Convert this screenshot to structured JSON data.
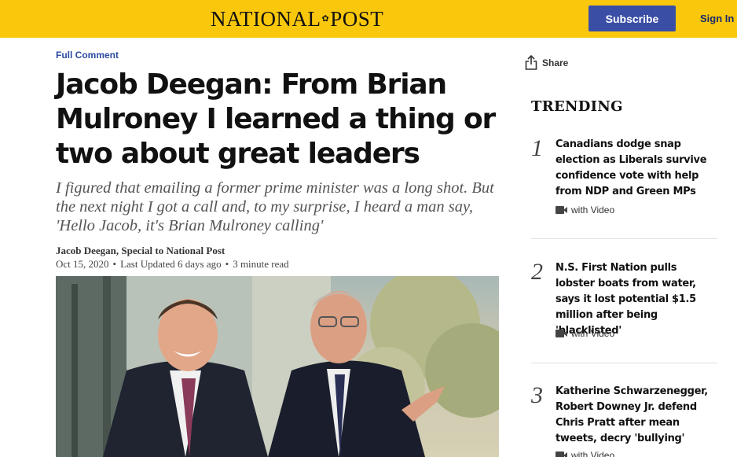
{
  "header": {
    "logo_left": "NATIONAL",
    "logo_right": "POST",
    "subscribe_label": "Subscribe",
    "signin_label": "Sign In",
    "brand_color": "#f9c70c",
    "subscribe_color": "#3b4ea5"
  },
  "article": {
    "category": "Full Comment",
    "headline": "Jacob Deegan: From Brian Mulroney I learned a thing or two about great leaders",
    "deck": "I figured that emailing a former prime minister was a long shot. But the next night I got a call and, to my surprise, I heard a man say, 'Hello Jacob, it's Brian Mulroney calling'",
    "byline": "Jacob Deegan, Special to National Post",
    "date": "Oct 15, 2020",
    "updated": "Last Updated 6 days ago",
    "read_time": "3 minute read"
  },
  "share": {
    "label": "Share",
    "icon": "share-icon"
  },
  "trending": {
    "title": "TRENDING",
    "items": [
      {
        "num": "1",
        "text": "Canadians dodge snap election as Liberals survive confidence vote with help from NDP and Green MPs",
        "tag": "with Video"
      },
      {
        "num": "2",
        "text": "N.S. First Nation pulls lobster boats from water, says it lost potential $1.5 million after being 'blacklisted'",
        "tag": "with Video"
      },
      {
        "num": "3",
        "text": "Katherine Schwarzenegger, Robert Downey Jr. defend Chris Pratt after mean tweets, decry 'bullying'",
        "tag": "with Video"
      }
    ]
  }
}
